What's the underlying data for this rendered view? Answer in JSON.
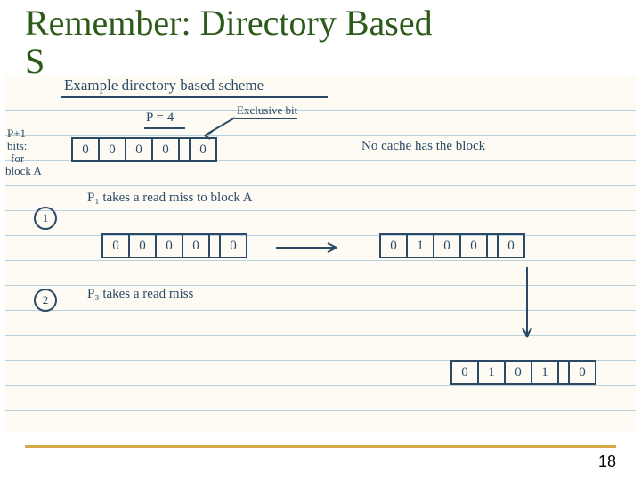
{
  "slide": {
    "title_line1": "Remember: Directory Based",
    "title_line2_partial": "S",
    "page_number": "18"
  },
  "notes": {
    "heading": "Example directory based scheme",
    "p_eq": "P = 4",
    "excl_bit": "Exclusive bit",
    "side_label_l1": "P+1",
    "side_label_l2": "bits:",
    "side_label_l3": "for",
    "side_label_l4": "block A",
    "no_cache": "No cache has the block",
    "step1": "P₁ takes a read miss to block A",
    "step2": "P₃ takes a read miss",
    "circ1": "1",
    "circ2": "2",
    "bits_top": [
      "0",
      "0",
      "0",
      "0",
      "0"
    ],
    "bits_mid_l": [
      "0",
      "0",
      "0",
      "0",
      "0"
    ],
    "bits_mid_r": [
      "0",
      "1",
      "0",
      "0",
      "0"
    ],
    "bits_bot": [
      "0",
      "1",
      "0",
      "1",
      "0"
    ]
  }
}
